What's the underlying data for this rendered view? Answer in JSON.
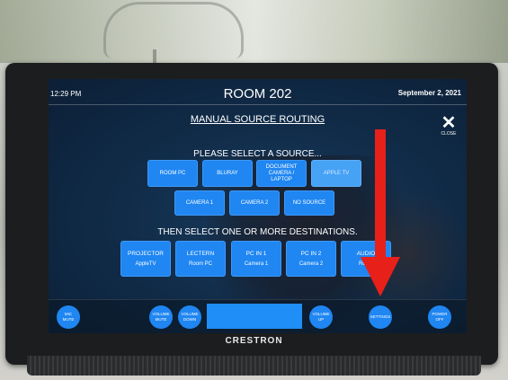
{
  "header": {
    "time": "12:29 PM",
    "room": "ROOM 202",
    "date": "September 2, 2021"
  },
  "page_title": "MANUAL SOURCE ROUTING",
  "close": {
    "icon": "close-icon",
    "label": "CLOSE"
  },
  "source_prompt": "PLEASE SELECT A SOURCE...",
  "sources": [
    {
      "label": "ROOM PC",
      "selected": false
    },
    {
      "label": "BLURAY",
      "selected": false
    },
    {
      "label": "DOCUMENT\nCAMERA /\nLAPTOP",
      "selected": false
    },
    {
      "label": "APPLE TV",
      "selected": true
    },
    {
      "label": "CAMERA 1",
      "selected": false
    },
    {
      "label": "CAMERA 2",
      "selected": false
    },
    {
      "label": "NO SOURCE",
      "selected": false
    }
  ],
  "destination_prompt": "THEN SELECT ONE OR MORE DESTINATIONS.",
  "destinations": [
    {
      "name": "PROJECTOR",
      "current": "AppleTV"
    },
    {
      "name": "LECTERN",
      "current": "Room PC"
    },
    {
      "name": "PC IN 1",
      "current": "Camera 1"
    },
    {
      "name": "PC IN 2",
      "current": "Camera 2"
    },
    {
      "name": "AUDIO",
      "current": "Room"
    }
  ],
  "bottom_bar": {
    "mic_mute": "MIC\nMUTE",
    "volume_mute": "VOLUME\nMUTE",
    "volume_down": "VOLUME\nDOWN",
    "volume_up": "VOLUME\nUP",
    "settings": "SETTINGS",
    "power_off": "POWER\nOFF"
  },
  "brand": "CRESTRON",
  "colors": {
    "button": "#1f86f2",
    "annotation_arrow": "#e8201a"
  }
}
